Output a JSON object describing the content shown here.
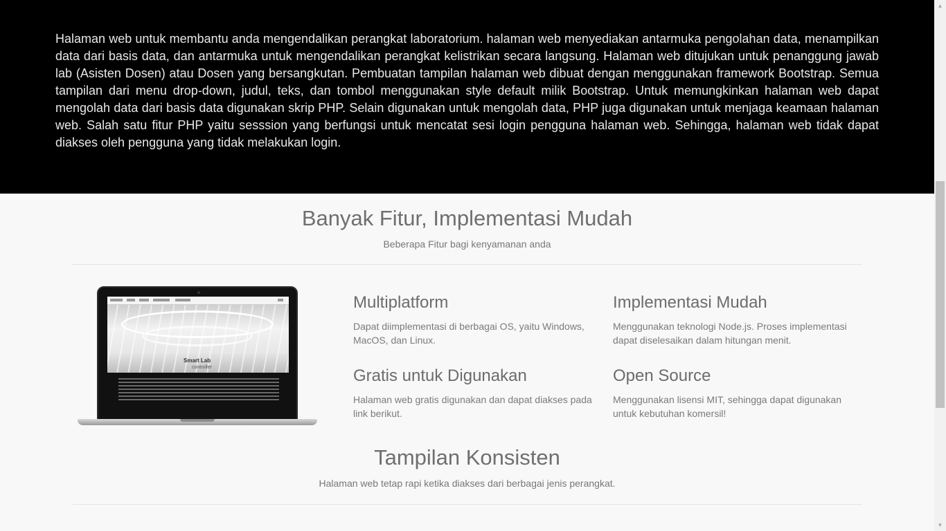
{
  "hero": {
    "paragraph": "Halaman web untuk membantu anda mengendalikan perangkat laboratorium. halaman web menyediakan antarmuka pengolahan data, menampilkan data dari basis data, dan antarmuka untuk mengendalikan perangkat kelistrikan secara langsung. Halaman web ditujukan untuk penanggung jawab lab (Asisten Dosen) atau Dosen yang bersangkutan. Pembuatan tampilan halaman web dibuat dengan menggunakan framework Bootstrap. Semua tampilan dari menu drop-down, judul, teks, dan tombol menggunakan style default milik Bootstrap. Untuk memungkinkan halaman web dapat mengolah data dari basis data digunakan skrip PHP. Selain digunakan untuk mengolah data, PHP juga digunakan untuk menjaga keamaan halaman web. Salah satu fitur PHP yaitu sesssion yang berfungsi untuk mencatat sesi login pengguna halaman web. Sehingga, halaman web tidak dapat diakses oleh pengguna yang tidak melakukan login."
  },
  "features_section": {
    "title": "Banyak Fitur, Implementasi Mudah",
    "subtitle": "Beberapa Fitur bagi kenyamanan anda",
    "items": [
      {
        "title": "Multiplatform",
        "text": "Dapat diimplementasi di berbagai OS, yaitu Windows, MacOS, dan Linux."
      },
      {
        "title": "Implementasi Mudah",
        "text": "Menggunakan teknologi Node.js. Proses implementasi dapat diselesaikan dalam hitungan menit."
      },
      {
        "title": "Gratis untuk Digunakan",
        "text": "Halaman web gratis digunakan dan dapat diakses pada link berikut."
      },
      {
        "title": "Open Source",
        "text": "Menggunakan lisensi MIT, sehingga dapat digunakan untuk kebutuhan komersil!"
      }
    ]
  },
  "laptop_screen": {
    "title_line1": "Smart Lab",
    "title_line2": "controller"
  },
  "consistent_section": {
    "title": "Tampilan Konsisten",
    "subtitle": "Halaman web tetap rapi ketika diakses dari berbagai jenis perangkat."
  },
  "scrollbar": {
    "up_icon": "▲",
    "down_icon": "▼"
  }
}
